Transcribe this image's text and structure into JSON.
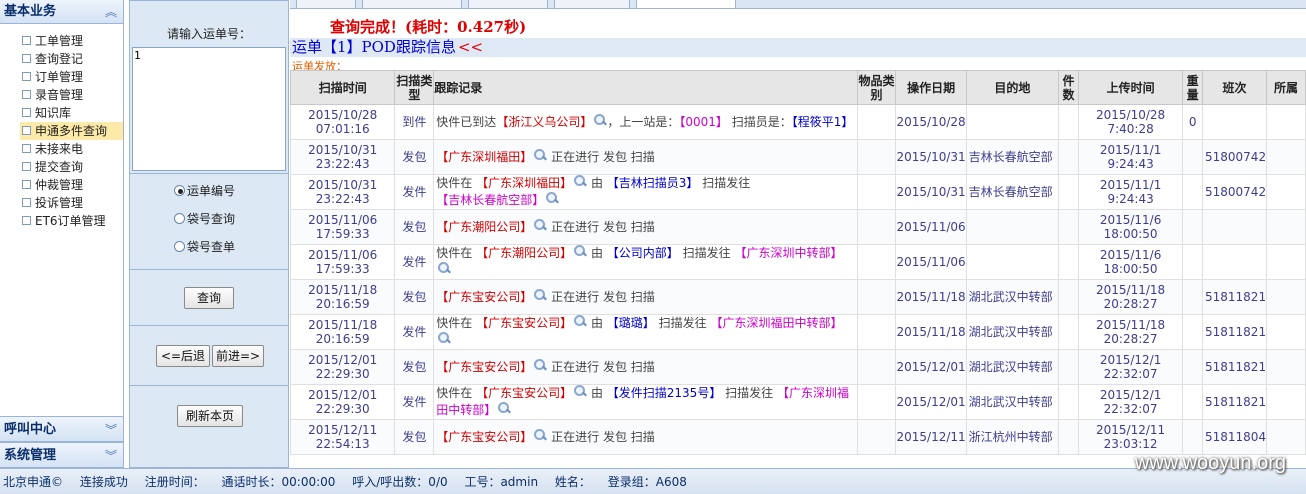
{
  "sidebar": {
    "header": "基本业务",
    "items": [
      {
        "label": "工单管理"
      },
      {
        "label": "查询登记"
      },
      {
        "label": "订单管理"
      },
      {
        "label": "录音管理"
      },
      {
        "label": "知识库"
      },
      {
        "label": "申通多件查询",
        "active": true
      },
      {
        "label": "未接来电"
      },
      {
        "label": "提交查询"
      },
      {
        "label": "仲裁管理"
      },
      {
        "label": "投诉管理"
      },
      {
        "label": "ET6订单管理"
      }
    ],
    "bottom_headers": [
      "呼叫中心",
      "系统管理"
    ]
  },
  "search": {
    "label": "请输入运单号：",
    "input_value": "1",
    "radios": [
      {
        "label": "运单编号",
        "checked": true
      },
      {
        "label": "袋号查询",
        "checked": false
      },
      {
        "label": "袋号查单",
        "checked": false
      }
    ],
    "query_btn": "查询",
    "back_btn": "<=后退",
    "forward_btn": "前进=>",
    "refresh_btn": "刷新本页"
  },
  "main": {
    "result": "查询完成！(耗时：0.427秒)",
    "title": "运单【1】POD跟踪信息",
    "title_suffix": "<<",
    "subtitle": "运单发放：",
    "columns": [
      "扫描时间",
      "扫描类型",
      "跟踪记录",
      "物品类别",
      "操作日期",
      "目的地",
      "件数",
      "上传时间",
      "重量",
      "班次",
      "所属"
    ],
    "rows": [
      {
        "scan_time": "2015/10/28 07:01:16",
        "type": "到件",
        "rec": [
          [
            "t",
            "快件已到达"
          ],
          [
            "r",
            "【浙江义乌公司】"
          ],
          [
            "i",
            ""
          ],
          [
            "t",
            "，上一站是："
          ],
          [
            "m",
            "【0001】"
          ],
          [
            "t",
            " 扫描员是："
          ],
          [
            "b",
            "【程筱平1】"
          ]
        ],
        "op_date": "2015/10/28",
        "dest": "",
        "upload": "2015/10/28 7:40:28",
        "weight": "0",
        "shift": ""
      },
      {
        "scan_time": "2015/10/31 23:22:43",
        "type": "发包",
        "rec": [
          [
            "r",
            "【广东深圳福田】"
          ],
          [
            "i",
            ""
          ],
          [
            "t",
            " 正在进行 发包 扫描"
          ]
        ],
        "op_date": "2015/10/31",
        "dest": "吉林长春航空部",
        "upload": "2015/11/1 9:24:43",
        "weight": "",
        "shift": "51800742"
      },
      {
        "scan_time": "2015/10/31 23:22:43",
        "type": "发件",
        "rec": [
          [
            "t",
            "快件在 "
          ],
          [
            "r",
            "【广东深圳福田】"
          ],
          [
            "i",
            ""
          ],
          [
            "t",
            " 由 "
          ],
          [
            "b",
            "【吉林扫描员3】"
          ],
          [
            "t",
            " 扫描发往 "
          ],
          [
            "m",
            "【吉林长春航空部】"
          ],
          [
            "i",
            ""
          ]
        ],
        "op_date": "2015/10/31",
        "dest": "吉林长春航空部",
        "upload": "2015/11/1 9:24:43",
        "weight": "",
        "shift": "51800742"
      },
      {
        "scan_time": "2015/11/06 17:59:33",
        "type": "发包",
        "rec": [
          [
            "r",
            "【广东潮阳公司】"
          ],
          [
            "i",
            ""
          ],
          [
            "t",
            " 正在进行 发包 扫描"
          ]
        ],
        "op_date": "2015/11/06",
        "dest": "",
        "upload": "2015/11/6 18:00:50",
        "weight": "",
        "shift": ""
      },
      {
        "scan_time": "2015/11/06 17:59:33",
        "type": "发件",
        "rec": [
          [
            "t",
            "快件在 "
          ],
          [
            "r",
            "【广东潮阳公司】"
          ],
          [
            "i",
            ""
          ],
          [
            "t",
            " 由 "
          ],
          [
            "b",
            "【公司内部】"
          ],
          [
            "t",
            " 扫描发往 "
          ],
          [
            "m",
            "【广东深圳中转部】"
          ],
          [
            "i",
            ""
          ]
        ],
        "op_date": "2015/11/06",
        "dest": "",
        "upload": "2015/11/6 18:00:50",
        "weight": "",
        "shift": ""
      },
      {
        "scan_time": "2015/11/18 20:16:59",
        "type": "发包",
        "rec": [
          [
            "r",
            "【广东宝安公司】"
          ],
          [
            "i",
            ""
          ],
          [
            "t",
            " 正在进行 发包 扫描"
          ]
        ],
        "op_date": "2015/11/18",
        "dest": "湖北武汉中转部",
        "upload": "2015/11/18 20:28:27",
        "weight": "",
        "shift": "51811821"
      },
      {
        "scan_time": "2015/11/18 20:16:59",
        "type": "发件",
        "rec": [
          [
            "t",
            "快件在 "
          ],
          [
            "r",
            "【广东宝安公司】"
          ],
          [
            "i",
            ""
          ],
          [
            "t",
            " 由 "
          ],
          [
            "b",
            "【璐璐】"
          ],
          [
            "t",
            " 扫描发往 "
          ],
          [
            "m",
            "【广东深圳福田中转部】"
          ],
          [
            "i",
            ""
          ]
        ],
        "op_date": "2015/11/18",
        "dest": "湖北武汉中转部",
        "upload": "2015/11/18 20:28:27",
        "weight": "",
        "shift": "51811821"
      },
      {
        "scan_time": "2015/12/01 22:29:30",
        "type": "发包",
        "rec": [
          [
            "r",
            "【广东宝安公司】"
          ],
          [
            "i",
            ""
          ],
          [
            "t",
            " 正在进行 发包 扫描"
          ]
        ],
        "op_date": "2015/12/01",
        "dest": "湖北武汉中转部",
        "upload": "2015/12/1 22:32:07",
        "weight": "",
        "shift": "51811821"
      },
      {
        "scan_time": "2015/12/01 22:29:30",
        "type": "发件",
        "rec": [
          [
            "t",
            "快件在 "
          ],
          [
            "r",
            "【广东宝安公司】"
          ],
          [
            "i",
            ""
          ],
          [
            "t",
            " 由 "
          ],
          [
            "b",
            "【发件扫描2135号】"
          ],
          [
            "t",
            " 扫描发往 "
          ],
          [
            "m",
            "【广东深圳福田中转部】"
          ],
          [
            "i",
            ""
          ]
        ],
        "op_date": "2015/12/01",
        "dest": "湖北武汉中转部",
        "upload": "2015/12/1 22:32:07",
        "weight": "",
        "shift": "51811821"
      },
      {
        "scan_time": "2015/12/11 22:54:13",
        "type": "发包",
        "rec": [
          [
            "r",
            "【广东宝安公司】"
          ],
          [
            "i",
            ""
          ],
          [
            "t",
            " 正在进行 发包 扫描"
          ]
        ],
        "op_date": "2015/12/11",
        "dest": "浙江杭州中转部",
        "upload": "2015/12/11 23:03:12",
        "weight": "",
        "shift": "51811804"
      }
    ]
  },
  "status": {
    "company": "北京申通©",
    "conn": "连接成功",
    "reg": "注册时间：",
    "talk": "通话时长：00:00:00",
    "calls": "呼入/呼出数：0/0",
    "worker": "工号：admin",
    "name": "姓名：",
    "group": "登录组：A608"
  },
  "watermark": "www.wooyun.org"
}
